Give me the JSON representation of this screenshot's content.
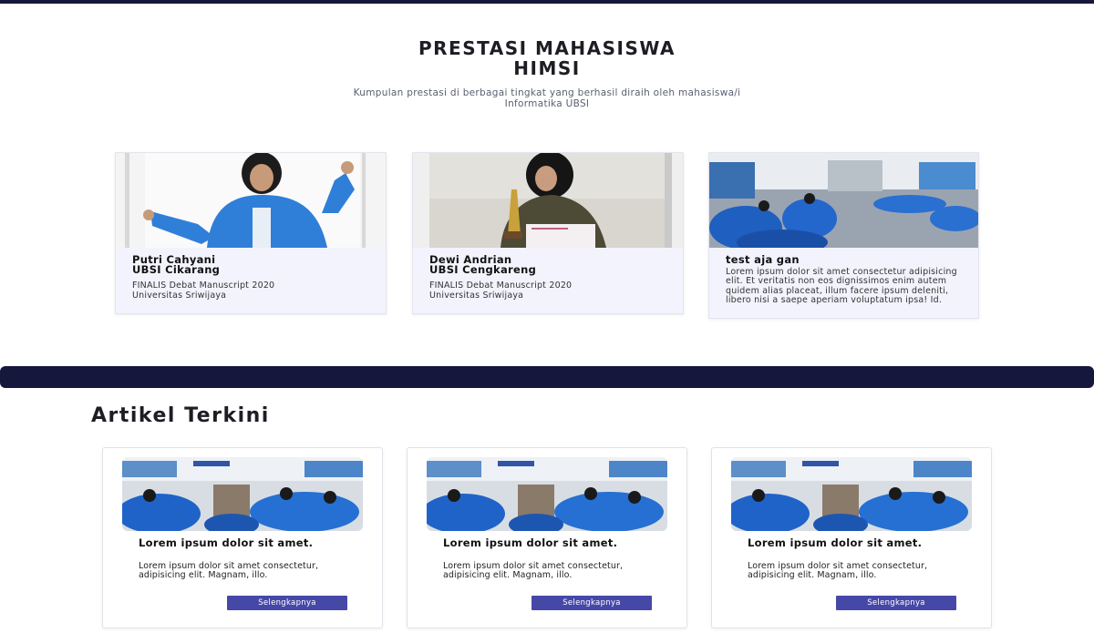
{
  "hero": {
    "title_line1": "PRESTASI MAHASISWA",
    "title_line2": "HIMSI",
    "subtitle": "Kumpulan prestasi di berbagai tingkat yang berhasil diraih oleh mahasiswa/i Informatika UBSI"
  },
  "achievements": [
    {
      "name_line1": "Putri Cahyani",
      "name_line2": "UBSI Cikarang",
      "desc_line1": "FINALIS Debat Manuscript 2020",
      "desc_line2": "Universitas Sriwijaya"
    },
    {
      "name_line1": "Dewi Andrian",
      "name_line2": "UBSI Cengkareng",
      "desc_line1": "FINALIS Debat Manuscript 2020",
      "desc_line2": "Universitas Sriwijaya"
    },
    {
      "name_line1": "test aja gan",
      "desc": "Lorem ipsum dolor sit amet consectetur adipisicing elit. Et veritatis non eos dignissimos enim autem quidem alias placeat, illum facere ipsum deleniti, libero nisi a saepe aperiam voluptatum ipsa! Id."
    }
  ],
  "articles_section": {
    "title": "Artikel Terkini"
  },
  "articles": [
    {
      "title": "Lorem ipsum dolor sit amet.",
      "text": "Lorem ipsum dolor sit amet consectetur, adipisicing elit. Magnam, illo.",
      "button": "Selengkapnya"
    },
    {
      "title": "Lorem ipsum dolor sit amet.",
      "text": "Lorem ipsum dolor sit amet consectetur, adipisicing elit. Magnam, illo.",
      "button": "Selengkapnya"
    },
    {
      "title": "Lorem ipsum dolor sit amet.",
      "text": "Lorem ipsum dolor sit amet consectetur, adipisicing elit. Magnam, illo.",
      "button": "Selengkapnya"
    }
  ],
  "colors": {
    "navy": "#15173d",
    "button": "#4648a8",
    "card_bg": "#f3f3fd"
  }
}
